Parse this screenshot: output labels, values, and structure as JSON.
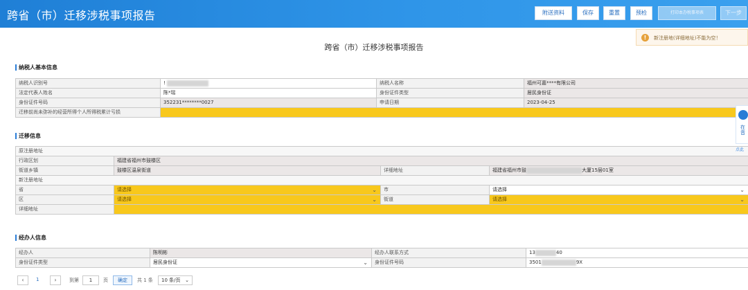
{
  "header": {
    "title": "跨省（市）迁移涉税事项报告",
    "buttons": [
      "附送资料",
      "保存",
      "重置",
      "预检",
      "打印本办税事项表",
      "下一步"
    ]
  },
  "toast": {
    "text": "新注册地(详细地址)不能为空！"
  },
  "doc_title": "跨省（市）迁移涉税事项报告",
  "taxpayer": {
    "section": "纳税人基本信息",
    "labels": {
      "id": "纳税人识别号",
      "name": "纳税人名称",
      "legal_rep": "法定代表人姓名",
      "id_type": "身份证件类型",
      "id_no": "身份证件号码",
      "apply_date": "申请日期",
      "iit": "迁移前尚未弥补的经营所得个人所得税累计亏损"
    },
    "values": {
      "id": "!",
      "name": "福州可嘉****有限公司",
      "legal_rep": "陈*瑶",
      "id_type": "居民身份证",
      "id_no": "352231********0027",
      "apply_date": "2023-04-25"
    }
  },
  "migration": {
    "section": "迁移信息",
    "orig_addr": "原注册地址",
    "district_label": "行政区划",
    "district_value": "福建省福州市鼓楼区",
    "street_label": "街道乡镇",
    "street_value": "鼓楼区温泉街道",
    "detail_label": "详细地址",
    "detail_value_a": "福建省福州市鼓",
    "detail_value_b": "大厦15层01室",
    "new_addr": "新注册地址",
    "province_label": "省",
    "city_label": "市",
    "district2_label": "区",
    "street2_label": "街道",
    "detail2_label": "详细地址",
    "placeholder": "请选择",
    "arrow": "⌄"
  },
  "handler": {
    "section": "经办人信息",
    "name_label": "经办人",
    "name_value": "陈明彬",
    "phone_label": "经办人联系方式",
    "phone_a": "13",
    "phone_b": "40",
    "id_type_label": "身份证件类型",
    "id_type_value": "居民身份证",
    "id_no_label": "身份证件号码",
    "id_no_a": "3501",
    "id_no_b": "9X"
  },
  "pagination": {
    "prev": "‹",
    "page": "1",
    "next": "›",
    "goto": "到第",
    "goto_value": "1",
    "page_unit": "页",
    "confirm": "确定",
    "total": "共 1 条",
    "page_size": "10 条/页"
  },
  "side_float": {
    "text_a": "在",
    "text_b": "音",
    "link": "点此"
  }
}
